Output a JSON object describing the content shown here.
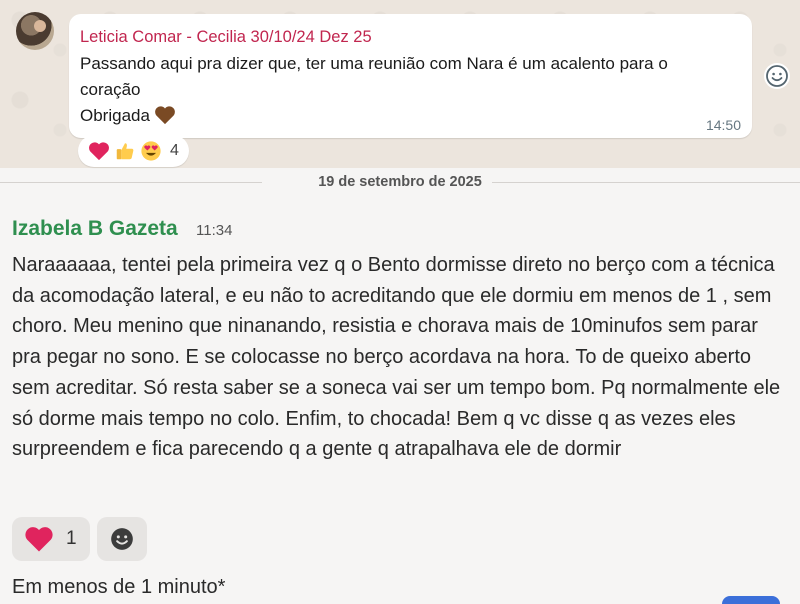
{
  "quoted_message": {
    "sender": "Leticia Comar - Cecilia 30/10/24 Dez 25",
    "text": "Passando aqui pra dizer que, ter uma reunião com Nara é um acalento para o\ncoração",
    "text_line3": "Obrigada",
    "time": "14:50",
    "reactions": {
      "emojis": [
        "heart-red",
        "thumbs-up",
        "heart-eyes"
      ],
      "count": "4"
    }
  },
  "date_divider": "19 de setembro de 2025",
  "message": {
    "sender": "Izabela B Gazeta",
    "time": "11:34",
    "text": "Naraaaaaa, tentei pela primeira vez q o Bento dormisse direto no berço com a técnica da acomodação lateral, e eu não to acreditando que ele dormiu em menos de 1 , sem choro. Meu menino que ninanando, resistia e chorava mais de 10minufos sem parar pra pegar no sono. E se colocasse no berço acordava na hora. To de queixo aberto sem acreditar. Só resta saber se a soneca vai ser um tempo bom. Pq normalmente ele só dorme mais tempo no colo. Enfim, to chocada! Bem q vc disse q as vezes eles surpreendem e fica parecendo q a gente q atrapalhava ele de dormir",
    "reaction": {
      "emoji": "heart-red",
      "count": "1"
    }
  },
  "next_message": {
    "text": "Em menos de 1 minuto*"
  },
  "colors": {
    "sender_pink": "#c1264f",
    "sender_green": "#2f8f4f",
    "heart_red": "#e0245e",
    "accent_blue": "#3b6fd9"
  }
}
